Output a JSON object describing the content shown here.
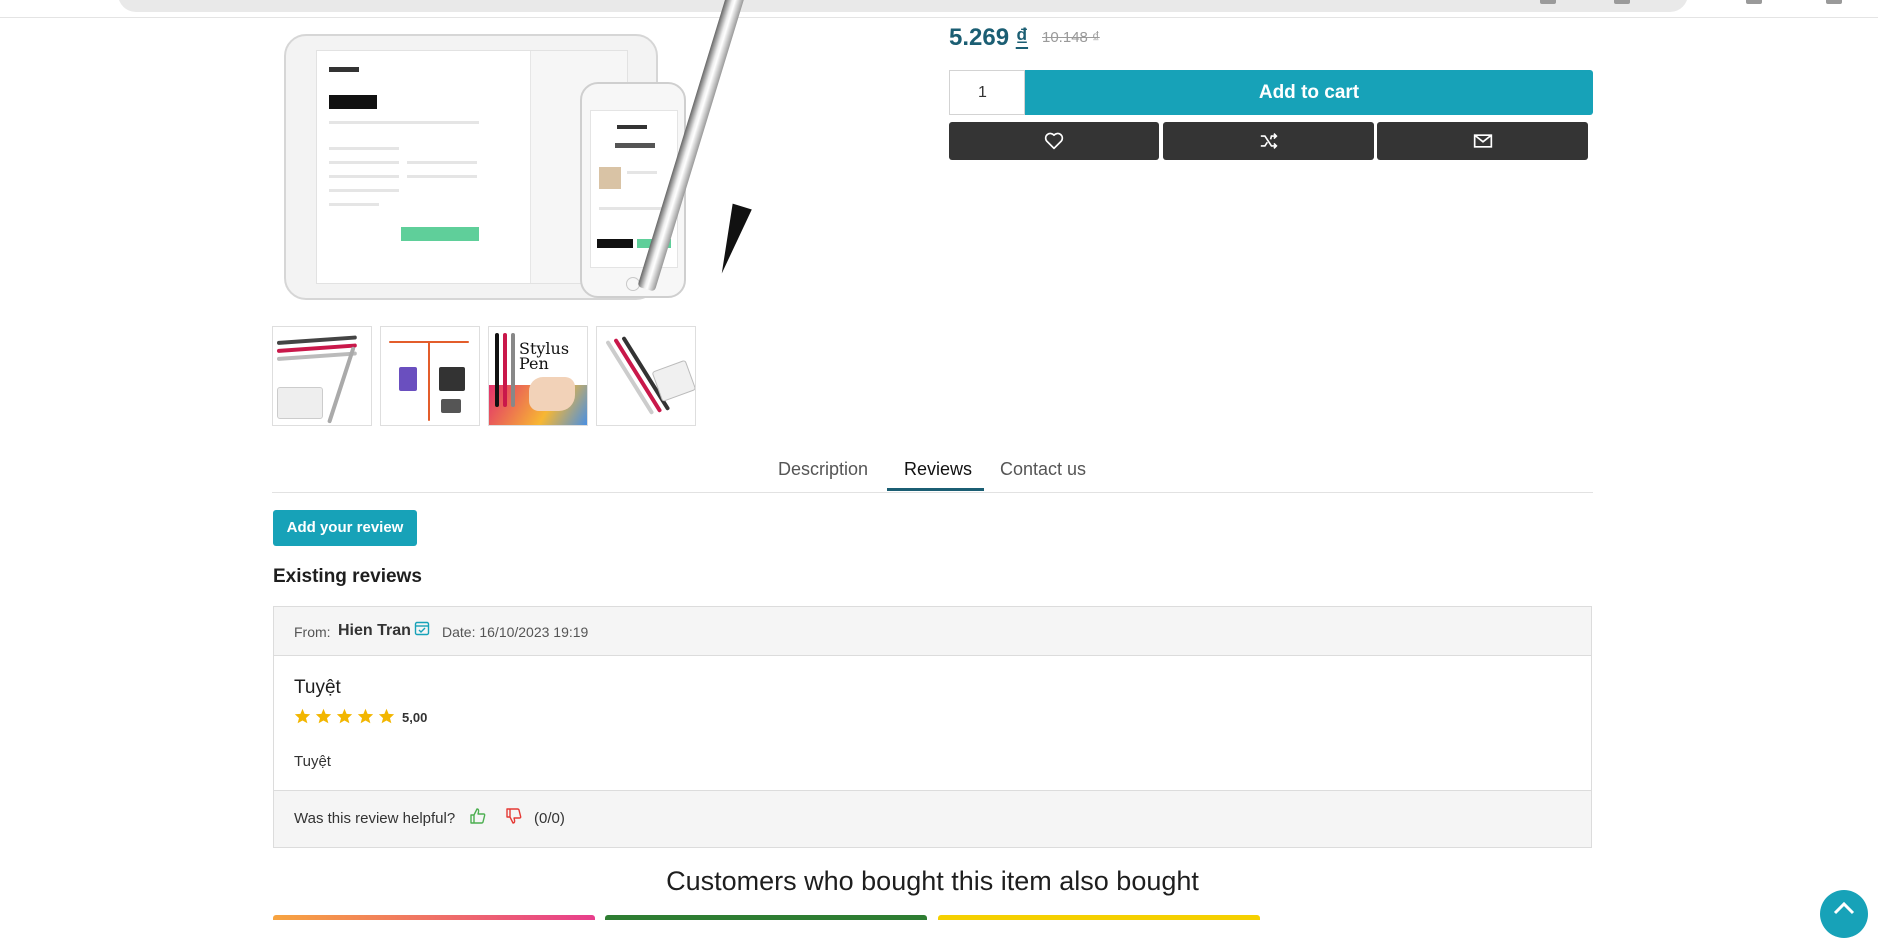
{
  "product": {
    "price": "5.269",
    "currency": "₫",
    "old_price": "10.148 ₫",
    "quantity": "1",
    "add_to_cart_label": "Add to cart"
  },
  "icons": {
    "wishlist": "heart-icon",
    "compare": "shuffle-icon",
    "email": "envelope-icon",
    "calendar": "calendar-icon",
    "helpful_yes": "thumbs-up-icon",
    "helpful_no": "thumbs-down-icon",
    "scroll_top": "chevron-up-icon"
  },
  "thumbnails": [
    {
      "alt": "stylus-pens-with-tablet"
    },
    {
      "alt": "capacitive-and-signature-screens"
    },
    {
      "alt": "stylus-pen",
      "text": "Stylus Pen"
    },
    {
      "alt": "stylus-pens-colors"
    }
  ],
  "tabs": [
    {
      "label": "Description"
    },
    {
      "label": "Reviews",
      "active": true
    },
    {
      "label": "Contact us"
    }
  ],
  "reviews_section": {
    "add_review_label": "Add your review",
    "existing_title": "Existing reviews",
    "review": {
      "from_label": "From:",
      "author": "Hien Tran",
      "date": "Date: 16/10/2023 19:19",
      "title": "Tuyệt",
      "rating": 5,
      "rating_text": "5,00",
      "text": "Tuyệt",
      "helpful_label": "Was this review helpful?",
      "helpful_counts": "(0/0)"
    }
  },
  "also_bought_title": "Customers who bought this item also bought",
  "colors": {
    "accent": "#17a2b8",
    "price": "#1b5e73",
    "action_bg": "#343434",
    "star": "#f2b600",
    "thumb_up": "#4caf50",
    "thumb_down": "#e53935"
  }
}
